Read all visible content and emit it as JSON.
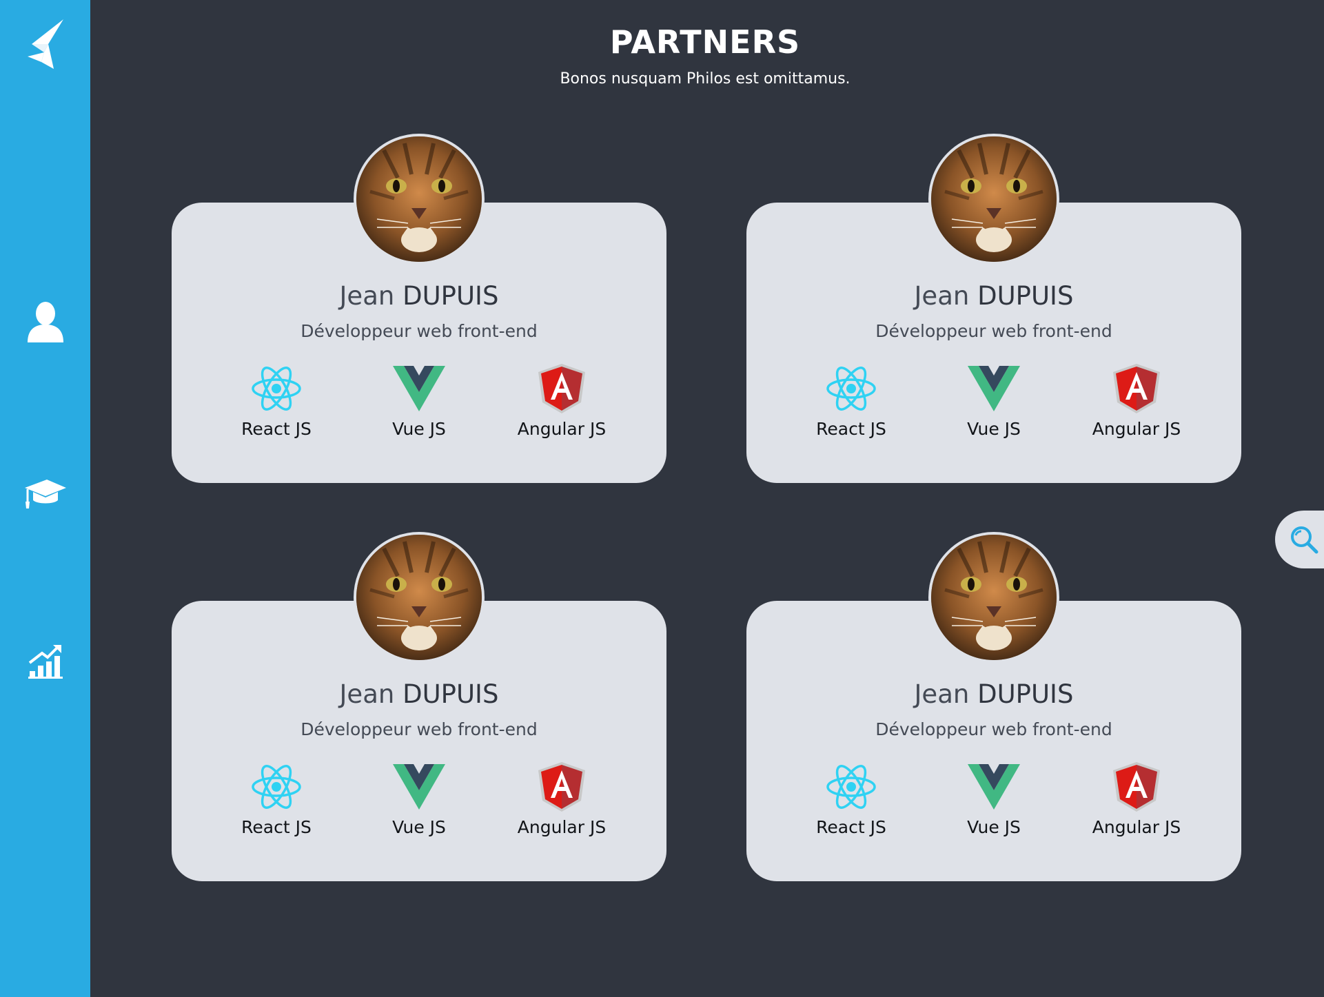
{
  "sidebar": {
    "items": [
      {
        "icon": "logo-icon"
      },
      {
        "icon": "user-icon"
      },
      {
        "icon": "graduation-cap-icon"
      },
      {
        "icon": "growth-chart-icon"
      }
    ],
    "color": "#29abe2"
  },
  "page": {
    "title": "PARTNERS",
    "subtitle": "Bonos nusquam Philos est omittamus.",
    "background": "#30353f"
  },
  "cards": [
    {
      "first_name": "Jean",
      "last_name": "DUPUIS",
      "role": "Développeur web front-end",
      "skills": [
        {
          "label": "React JS",
          "icon": "react-icon"
        },
        {
          "label": "Vue JS",
          "icon": "vue-icon"
        },
        {
          "label": "Angular JS",
          "icon": "angular-icon"
        }
      ]
    },
    {
      "first_name": "Jean",
      "last_name": "DUPUIS",
      "role": "Développeur web front-end",
      "skills": [
        {
          "label": "React JS",
          "icon": "react-icon"
        },
        {
          "label": "Vue JS",
          "icon": "vue-icon"
        },
        {
          "label": "Angular JS",
          "icon": "angular-icon"
        }
      ]
    },
    {
      "first_name": "Jean",
      "last_name": "DUPUIS",
      "role": "Développeur web front-end",
      "skills": [
        {
          "label": "React JS",
          "icon": "react-icon"
        },
        {
          "label": "Vue JS",
          "icon": "vue-icon"
        },
        {
          "label": "Angular JS",
          "icon": "angular-icon"
        }
      ]
    },
    {
      "first_name": "Jean",
      "last_name": "DUPUIS",
      "role": "Développeur web front-end",
      "skills": [
        {
          "label": "React JS",
          "icon": "react-icon"
        },
        {
          "label": "Vue JS",
          "icon": "vue-icon"
        },
        {
          "label": "Angular JS",
          "icon": "angular-icon"
        }
      ]
    }
  ],
  "search": {
    "icon": "search-icon"
  }
}
